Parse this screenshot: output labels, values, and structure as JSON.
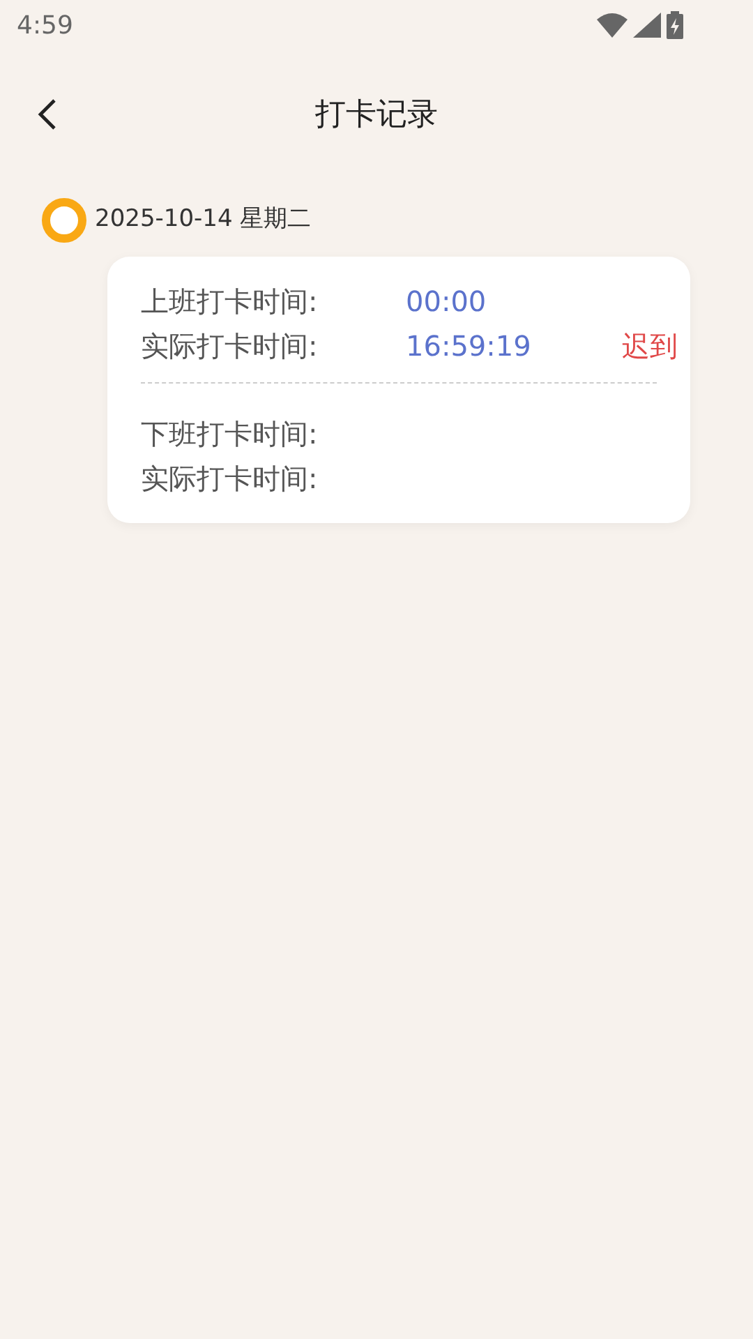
{
  "status_bar": {
    "time": "4:59"
  },
  "header": {
    "title": "打卡记录"
  },
  "records": [
    {
      "date": "2025-10-14 星期二",
      "sections": [
        {
          "rows": [
            {
              "label": "上班打卡时间:",
              "value": "00:00"
            },
            {
              "label": "实际打卡时间:",
              "value": "16:59:19",
              "status": "迟到"
            }
          ]
        },
        {
          "rows": [
            {
              "label": "下班打卡时间:"
            },
            {
              "label": "实际打卡时间:"
            }
          ]
        }
      ]
    }
  ]
}
